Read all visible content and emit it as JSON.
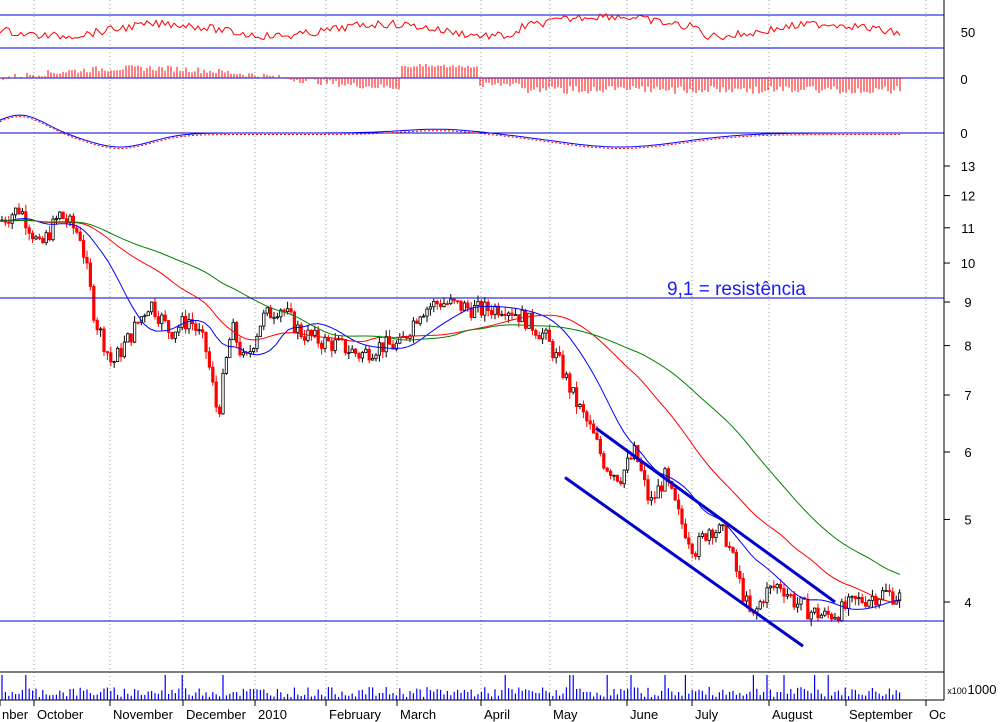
{
  "chart_data": {
    "type": "candlestick",
    "y_scale": "log",
    "price_axis": {
      "ticks": [
        "13",
        "12",
        "11",
        "10",
        "9",
        "8",
        "7",
        "6",
        "5",
        "4"
      ],
      "values": [
        13,
        12,
        11,
        10,
        9,
        8,
        7,
        6,
        5,
        4
      ]
    },
    "oscillator_top_ticks": [
      "50"
    ],
    "oscillator_mid_ticks": [
      "0"
    ],
    "oscillator_low_ticks": [
      "0"
    ],
    "volume_axis": {
      "tick": "1000",
      "unit_label": "x100"
    },
    "months": [
      "nber",
      "October",
      "November",
      "December",
      "2010",
      "February",
      "March",
      "April",
      "May",
      "June",
      "July",
      "August",
      "September",
      "Oc"
    ],
    "annotation": "9,1 = resistência",
    "horizontal_levels": [
      {
        "role": "resistance",
        "value": 9.1
      },
      {
        "role": "support",
        "value": 3.8
      }
    ],
    "channel_lines": [
      {
        "role": "upper",
        "from": {
          "date": "May",
          "value": 6.4
        },
        "to": {
          "date": "August",
          "value": 4.0
        }
      },
      {
        "role": "lower",
        "from": {
          "date": "May",
          "value": 5.6
        },
        "to": {
          "date": "August",
          "value": 3.55
        }
      }
    ],
    "colors": {
      "line_blue": "#0000cc",
      "up_candle": "#000000",
      "down_candle": "#ff0000",
      "ma_short": "#0000ff",
      "ma_mid": "#ff0000",
      "ma_long": "#008000",
      "grid": "#999999",
      "annotation": "#1a1aff"
    }
  }
}
